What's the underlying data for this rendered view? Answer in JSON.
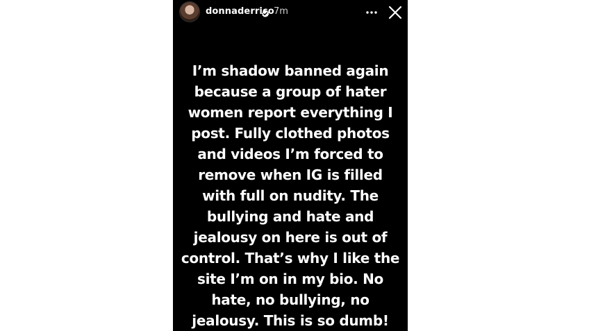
{
  "story": {
    "username": "donnaderrico",
    "timestamp": "7m",
    "text_lines": [
      "I’m shadow banned again",
      "because a group of hater",
      "women report everything I",
      "post. Fully clothed photos",
      "and videos I’m forced to",
      "remove when IG is filled",
      "with full on nudity. The",
      "bullying and hate and",
      "jealousy on here is out of",
      "control. That’s why I like the",
      "site I’m on in my bio. No",
      "hate, no bullying, no",
      "jealousy. This is so dumb!"
    ]
  },
  "icons": {
    "verified": "verified-badge-icon",
    "more": "more-options-icon",
    "close": "close-icon"
  },
  "colors": {
    "story_background": "#000000",
    "page_background": "#ffffff",
    "text": "#ffffff",
    "verified_badge": "#ffffff"
  }
}
